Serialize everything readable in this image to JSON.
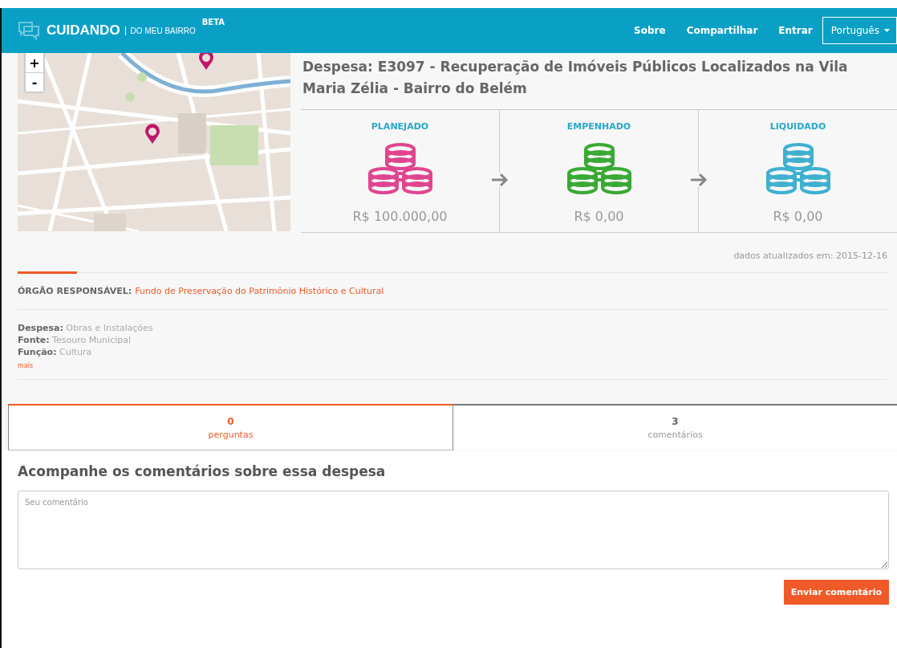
{
  "header": {
    "logo": "CUIDANDO",
    "subtitle": "DO MEU BAIRRO",
    "badge": "BETA",
    "nav": [
      "Sobre",
      "Compartilhar",
      "Entrar"
    ],
    "language": "Português"
  },
  "map": {
    "kind": "picture",
    "zoom_in": "+",
    "zoom_out": "-"
  },
  "title": "Despesa: E3097 - Recuperação de Imóveis Públicos Localizados na Vila Maria Zélia - Bairro do Belém",
  "stages": [
    {
      "label": "PLANEJADO",
      "amount": "R$ 100.000,00",
      "color": "#e0458f"
    },
    {
      "label": "EMPENHADO",
      "amount": "R$ 0,00",
      "color": "#3aa935"
    },
    {
      "label": "LIQUIDADO",
      "amount": "R$ 0,00",
      "color": "#3fb0d0"
    }
  ],
  "updated": "dados atualizados em: 2015-12-16",
  "responsible": {
    "label": "ÓRGÃO RESPONSÁVEL:",
    "value": "Fundo de Preservação do Patrimônio Histórico e Cultural"
  },
  "details": [
    {
      "label": "Despesa:",
      "value": "Obras e Instalações"
    },
    {
      "label": "Fonte:",
      "value": "Tesouro Municipal"
    },
    {
      "label": "Função:",
      "value": "Cultura"
    }
  ],
  "more": "mais",
  "tabs": [
    {
      "count": "0",
      "label": "perguntas",
      "selected": true
    },
    {
      "count": "3",
      "label": "comentários",
      "selected": false
    }
  ],
  "comments": {
    "heading": "Acompanhe os comentários sobre essa despesa",
    "placeholder": "Seu comentário",
    "submit": "Enviar comentário"
  }
}
